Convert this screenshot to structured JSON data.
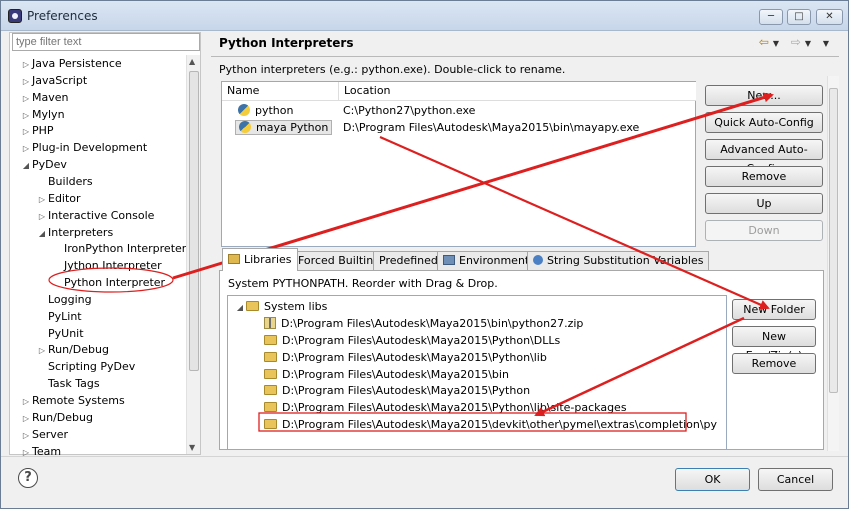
{
  "window": {
    "title": "Preferences",
    "controls": {
      "minimize": "─",
      "maximize": "□",
      "close": "✕"
    }
  },
  "sidebar": {
    "filter_placeholder": "type filter text",
    "items": [
      {
        "label": "Java Persistence",
        "level": 0,
        "expander": "▷"
      },
      {
        "label": "JavaScript",
        "level": 0,
        "expander": "▷"
      },
      {
        "label": "Maven",
        "level": 0,
        "expander": "▷"
      },
      {
        "label": "Mylyn",
        "level": 0,
        "expander": "▷"
      },
      {
        "label": "PHP",
        "level": 0,
        "expander": "▷"
      },
      {
        "label": "Plug-in Development",
        "level": 0,
        "expander": "▷"
      },
      {
        "label": "PyDev",
        "level": 0,
        "expander": "◢"
      },
      {
        "label": "Builders",
        "level": 1,
        "expander": ""
      },
      {
        "label": "Editor",
        "level": 1,
        "expander": "▷"
      },
      {
        "label": "Interactive Console",
        "level": 1,
        "expander": "▷"
      },
      {
        "label": "Interpreters",
        "level": 1,
        "expander": "◢"
      },
      {
        "label": "IronPython Interpreter",
        "level": 2,
        "expander": ""
      },
      {
        "label": "Jython Interpreter",
        "level": 2,
        "expander": ""
      },
      {
        "label": "Python Interpreter",
        "level": 2,
        "expander": ""
      },
      {
        "label": "Logging",
        "level": 1,
        "expander": ""
      },
      {
        "label": "PyLint",
        "level": 1,
        "expander": ""
      },
      {
        "label": "PyUnit",
        "level": 1,
        "expander": ""
      },
      {
        "label": "Run/Debug",
        "level": 1,
        "expander": "▷"
      },
      {
        "label": "Scripting PyDev",
        "level": 1,
        "expander": ""
      },
      {
        "label": "Task Tags",
        "level": 1,
        "expander": ""
      },
      {
        "label": "Remote Systems",
        "level": 0,
        "expander": "▷"
      },
      {
        "label": "Run/Debug",
        "level": 0,
        "expander": "▷"
      },
      {
        "label": "Server",
        "level": 0,
        "expander": "▷"
      },
      {
        "label": "Team",
        "level": 0,
        "expander": "▷"
      }
    ]
  },
  "page": {
    "title": "Python Interpreters",
    "description": "Python interpreters (e.g.: python.exe).   Double-click to rename."
  },
  "interpreters": {
    "columns": [
      "Name",
      "Location"
    ],
    "rows": [
      {
        "name": "python",
        "location": "C:\\Python27\\python.exe"
      },
      {
        "name": "maya Python",
        "location": "D:\\Program Files\\Autodesk\\Maya2015\\bin\\mayapy.exe"
      }
    ],
    "buttons": [
      "New...",
      "Quick Auto-Config",
      "Advanced Auto-Config",
      "Remove",
      "Up",
      "Down"
    ]
  },
  "tabs": [
    "Libraries",
    "Forced Builtins",
    "Predefined",
    "Environment",
    "String Substitution Variables"
  ],
  "libraries": {
    "description": "System PYTHONPATH.   Reorder with Drag & Drop.",
    "root": "System libs",
    "paths": [
      "D:\\Program Files\\Autodesk\\Maya2015\\bin\\python27.zip",
      "D:\\Program Files\\Autodesk\\Maya2015\\Python\\DLLs",
      "D:\\Program Files\\Autodesk\\Maya2015\\Python\\lib",
      "D:\\Program Files\\Autodesk\\Maya2015\\bin",
      "D:\\Program Files\\Autodesk\\Maya2015\\Python",
      "D:\\Program Files\\Autodesk\\Maya2015\\Python\\lib\\site-packages",
      "D:\\Program Files\\Autodesk\\Maya2015\\devkit\\other\\pymel\\extras\\completion\\py"
    ],
    "buttons": [
      "New Folder",
      "New Egg/Zip(s)",
      "Remove"
    ]
  },
  "footer": {
    "help": "?",
    "ok": "OK",
    "cancel": "Cancel"
  },
  "annotation_color": "#dd1f1f"
}
